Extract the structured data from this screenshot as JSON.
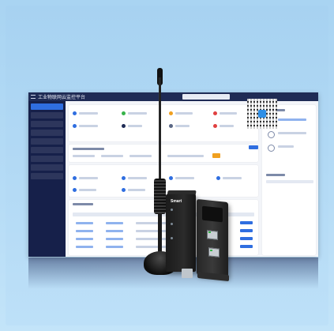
{
  "screen": {
    "brand": "工业物联网云监控平台",
    "device_label": "Smart"
  },
  "colors": {
    "background": "#b6dcf6",
    "topbar": "#1f2b55",
    "sidebar": "#16204a",
    "accent": "#2f6ee0",
    "device": "#1b1b1b"
  },
  "icons": [
    "menu-icon",
    "qr-code-icon",
    "antenna-icon",
    "router-icon"
  ]
}
